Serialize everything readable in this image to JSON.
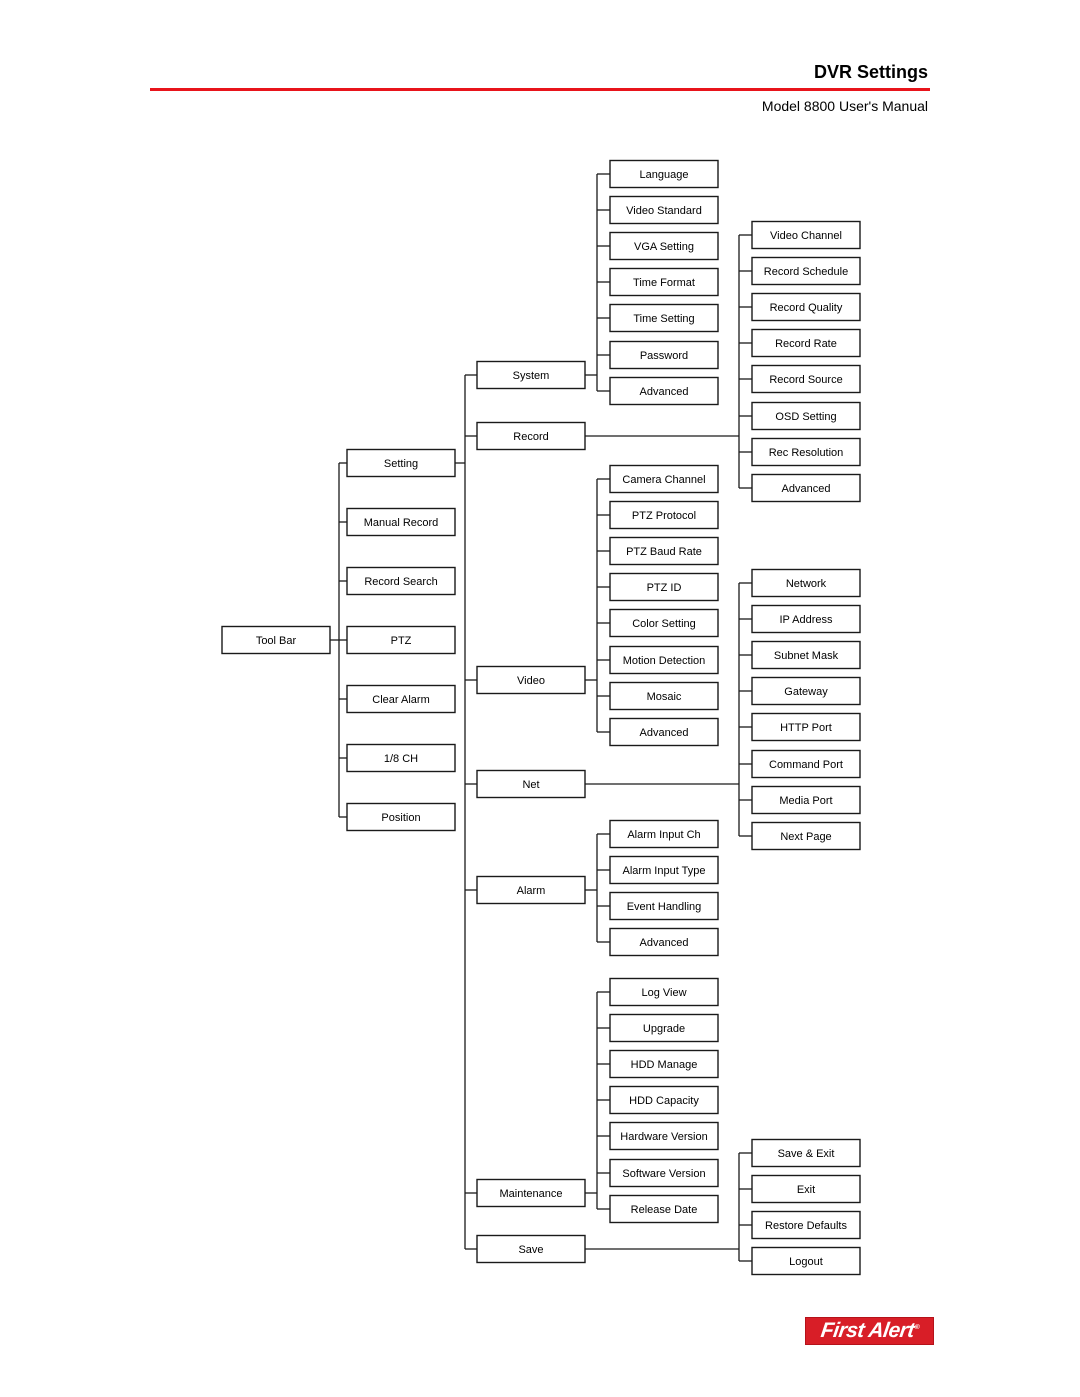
{
  "header": {
    "title": "DVR Settings",
    "subtitle": "Model 8800 User's Manual",
    "rule_color": "#e8141b"
  },
  "logo": {
    "text": "First Alert",
    "registered": "®",
    "color": "#d81e27"
  },
  "tree": {
    "label": "Tool Bar",
    "children": [
      {
        "label": "Setting",
        "children": [
          {
            "label": "System",
            "children": [
              {
                "label": "Language"
              },
              {
                "label": "Video Standard"
              },
              {
                "label": "VGA Setting"
              },
              {
                "label": "Time Format"
              },
              {
                "label": "Time Setting"
              },
              {
                "label": "Password"
              },
              {
                "label": "Advanced"
              }
            ]
          },
          {
            "label": "Record",
            "children": [
              {
                "label": "Video Channel"
              },
              {
                "label": "Record Schedule"
              },
              {
                "label": "Record Quality"
              },
              {
                "label": "Record Rate"
              },
              {
                "label": "Record Source"
              },
              {
                "label": "OSD Setting"
              },
              {
                "label": "Rec Resolution"
              },
              {
                "label": "Advanced"
              }
            ]
          },
          {
            "label": "Video",
            "children": [
              {
                "label": "Camera Channel"
              },
              {
                "label": "PTZ Protocol"
              },
              {
                "label": "PTZ Baud Rate"
              },
              {
                "label": "PTZ ID"
              },
              {
                "label": "Color Setting"
              },
              {
                "label": "Motion Detection"
              },
              {
                "label": "Mosaic"
              },
              {
                "label": "Advanced"
              }
            ]
          },
          {
            "label": "Net",
            "children": [
              {
                "label": "Network"
              },
              {
                "label": "IP Address"
              },
              {
                "label": "Subnet Mask"
              },
              {
                "label": "Gateway"
              },
              {
                "label": "HTTP Port"
              },
              {
                "label": "Command Port"
              },
              {
                "label": "Media Port"
              },
              {
                "label": "Next Page"
              }
            ]
          },
          {
            "label": "Alarm",
            "children": [
              {
                "label": "Alarm Input Ch"
              },
              {
                "label": "Alarm Input Type"
              },
              {
                "label": "Event Handling"
              },
              {
                "label": "Advanced"
              }
            ]
          },
          {
            "label": "Maintenance",
            "children": [
              {
                "label": "Log View"
              },
              {
                "label": "Upgrade"
              },
              {
                "label": "HDD Manage"
              },
              {
                "label": "HDD Capacity"
              },
              {
                "label": "Hardware Version"
              },
              {
                "label": "Software Version"
              },
              {
                "label": "Release Date"
              }
            ]
          },
          {
            "label": "Save",
            "children": [
              {
                "label": "Save & Exit"
              },
              {
                "label": "Exit"
              },
              {
                "label": "Restore Defaults"
              },
              {
                "label": "Logout"
              }
            ]
          }
        ]
      },
      {
        "label": "Manual Record"
      },
      {
        "label": "Record Search"
      },
      {
        "label": "PTZ"
      },
      {
        "label": "Clear Alarm"
      },
      {
        "label": "1/8 CH"
      },
      {
        "label": "Position"
      }
    ]
  }
}
